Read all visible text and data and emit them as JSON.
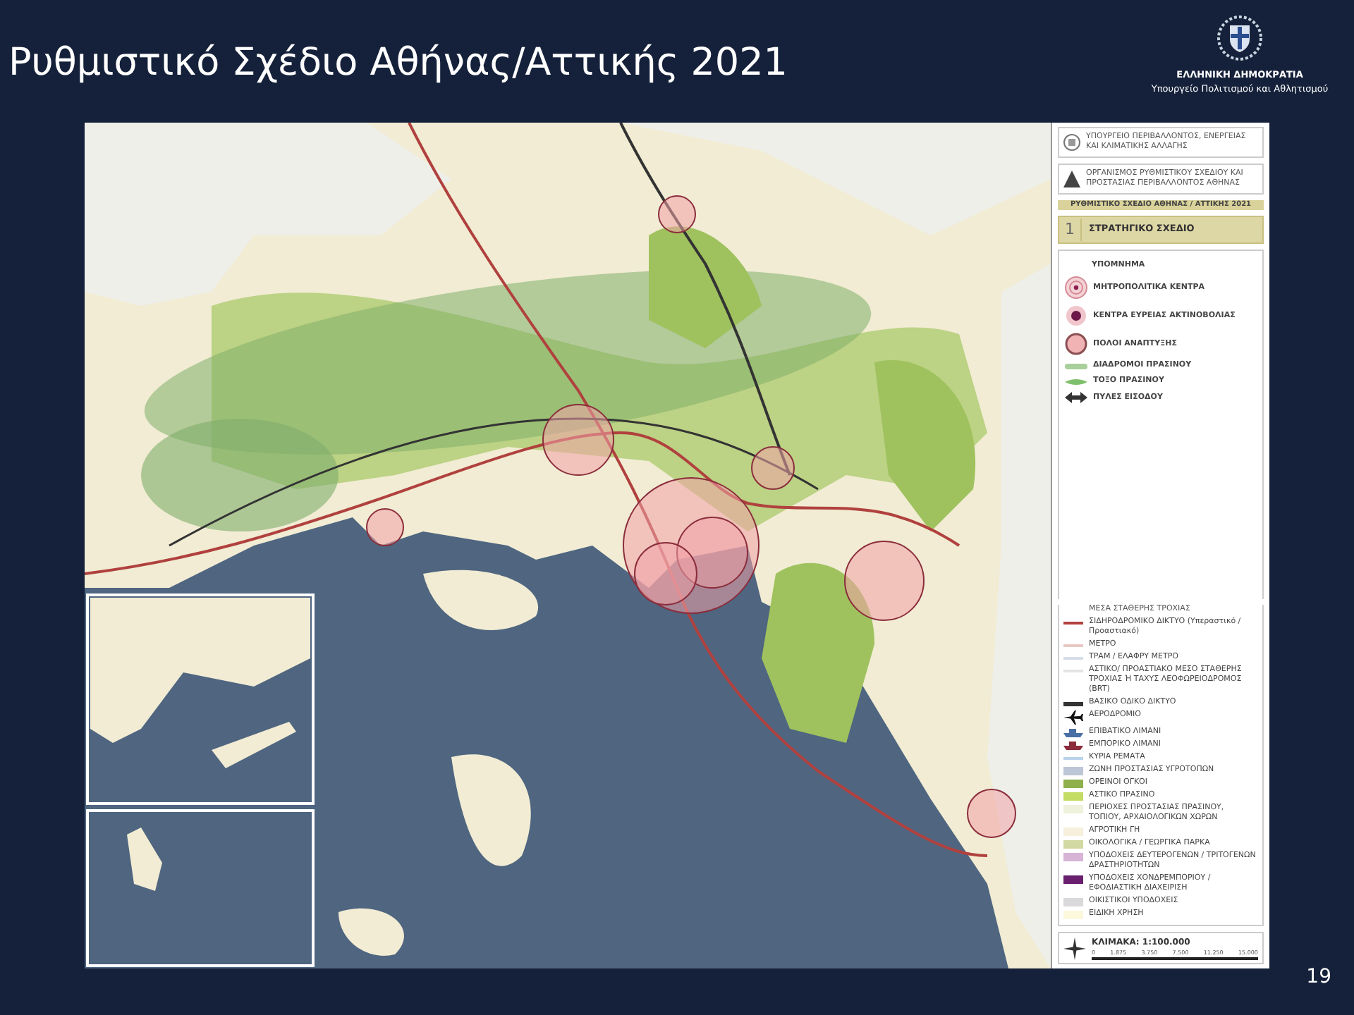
{
  "slide": {
    "title": "Ρυθμιστικό Σχέδιο Αθήνας/Αττικής 2021",
    "page_number": "19"
  },
  "branding": {
    "country": "ΕΛΛΗΝΙΚΗ ΔΗΜΟΚΡΑΤΙΑ",
    "ministry": "Υπουργείο Πολιτισμού και Αθλητισμού"
  },
  "legend": {
    "ministry": "ΥΠΟΥΡΓΕΙΟ ΠΕΡΙΒΑΛΛΟΝΤΟΣ, ΕΝΕΡΓΕΙΑΣ ΚΑΙ ΚΛΙΜΑΤΙΚΗΣ ΑΛΛΑΓΗΣ",
    "organization": "ΟΡΓΑΝΙΣΜΟΣ ΡΥΘΜΙΣΤΙΚΟΥ ΣΧΕΔΙΟΥ ΚΑΙ ΠΡΟΣΤΑΣΙΑΣ ΠΕΡΙΒΑΛΛΟΝΤΟΣ ΑΘΗΝΑΣ",
    "plan_title": "ΡΥΘΜΙΣΤΙΚΟ ΣΧΕΔΙΟ ΑΘΗΝΑΣ / ΑΤΤΙΚΗΣ 2021",
    "section_number": "1",
    "section_title": "ΣΤΡΑΤΗΓΙΚΟ ΣΧΕΔΙΟ",
    "heading": "ΥΠΟΜΝΗΜΑ",
    "symbols": [
      {
        "kind": "target",
        "label": "ΜΗΤΡΟΠΟΛΙΤΙΚΑ ΚΕΝΤΡΑ"
      },
      {
        "kind": "dot",
        "label": "ΚΕΝΤΡΑ ΕΥΡΕΙΑΣ ΑΚΤΙΝΟΒΟΛΙΑΣ"
      },
      {
        "kind": "pole",
        "label": "ΠΟΛΟΙ ΑΝΑΠΤΥΞΗΣ"
      },
      {
        "kind": "band",
        "label": "ΔΙΑΔΡΟΜΟΙ ΠΡΑΣΙΝΟΥ"
      },
      {
        "kind": "arc",
        "label": "ΤΟΞΟ ΠΡΑΣΙΝΟΥ"
      },
      {
        "kind": "gate",
        "label": "ΠΥΛΕΣ ΕΙΣΟΔΟΥ"
      }
    ],
    "features": [
      {
        "kind": "heading",
        "label": "ΜΕΣΑ ΣΤΑΘΕΡΗΣ ΤΡΟΧΙΑΣ"
      },
      {
        "kind": "line",
        "color": "#b0413e",
        "label": "ΣΙΔΗΡΟΔΡΟΜΙΚΟ ΔΙΚΤΥΟ (Υπεραστικό / Προαστιακό)"
      },
      {
        "kind": "line",
        "color": "#e8c9c4",
        "label": "ΜΕΤΡΟ"
      },
      {
        "kind": "line",
        "color": "#d6dde6",
        "label": "ΤΡΑΜ / ΕΛΑΦΡΥ ΜΕΤΡΟ"
      },
      {
        "kind": "line",
        "color": "#e4e4e4",
        "label": "ΑΣΤΙΚΟ/ ΠΡΟΑΣΤΙΑΚΟ ΜΕΣΟ ΣΤΑΘΕΡΗΣ ΤΡΟΧΙΑΣ Ή ΤΑΧΥΣ ΛΕΟΦΩΡΕΙΟΔΡΟΜΟΣ (BRT)"
      },
      {
        "kind": "road",
        "color": "#333333",
        "label": "ΒΑΣΙΚΟ ΟΔΙΚΟ ΔΙΚΤΥΟ"
      },
      {
        "kind": "plane",
        "color": "#111111",
        "label": "ΑΕΡΟΔΡΟΜΙΟ"
      },
      {
        "kind": "ship",
        "color": "#4a6fa5",
        "label": "ΕΠΙΒΑΤΙΚΟ ΛΙΜΑΝΙ"
      },
      {
        "kind": "ship",
        "color": "#8b2d3c",
        "label": "ΕΜΠΟΡΙΚΟ ΛΙΜΑΝΙ"
      },
      {
        "kind": "line",
        "color": "#b9d3ea",
        "label": "ΚΥΡΙΑ ΡΕΜΑΤΑ"
      },
      {
        "kind": "swatch",
        "color": "#bcc6d6",
        "label": "ΖΩΝΗ ΠΡΟΣΤΑΣΙΑΣ ΥΓΡΟΤΟΠΩΝ"
      },
      {
        "kind": "swatch",
        "color": "#8fb04a",
        "label": "ΟΡΕΙΝΟΙ ΟΓΚΟΙ"
      },
      {
        "kind": "swatch",
        "color": "#c3dc64",
        "label": "ΑΣΤΙΚΟ ΠΡΑΣΙΝΟ"
      },
      {
        "kind": "swatch",
        "color": "#eef2dc",
        "label": "ΠΕΡΙΟΧΕΣ ΠΡΟΣΤΑΣΙΑΣ ΠΡΑΣΙΝΟΥ, ΤΟΠΙΟΥ, ΑΡΧΑΙΟΛΟΓΙΚΩΝ ΧΩΡΩΝ"
      },
      {
        "kind": "swatch",
        "color": "#f6f0dc",
        "label": "ΑΓΡΟΤΙΚΗ ΓΗ"
      },
      {
        "kind": "swatch",
        "color": "#d3d9a3",
        "label": "ΟΙΚΟΛΟΓΙΚΑ / ΓΕΩΡΓΙΚΑ ΠΑΡΚΑ"
      },
      {
        "kind": "swatch",
        "color": "#d7b3d6",
        "label": "ΥΠΟΔΟΧΕΙΣ ΔΕΥΤΕΡΟΓΕΝΩΝ / ΤΡΙΤΟΓΕΝΩΝ ΔΡΑΣΤΗΡΙΟΤΗΤΩΝ"
      },
      {
        "kind": "swatch",
        "color": "#6a1f6e",
        "label": "ΥΠΟΔΟΧΕΙΣ ΧΟΝΔΡΕΜΠΟΡΙΟΥ / ΕΦΟΔΙΑΣΤΙΚΗ ΔΙΑΧΕΙΡΙΣΗ"
      },
      {
        "kind": "swatch",
        "color": "#d9d9dc",
        "label": "ΟΙΚΙΣΤΙΚΟΙ ΥΠΟΔΟΧΕΙΣ"
      },
      {
        "kind": "swatch",
        "color": "#fbf8dc",
        "label": "ΕΙΔΙΚΗ ΧΡΗΣΗ"
      }
    ],
    "scale": "ΚΛΙΜΑΚΑ: 1:100.000",
    "scale_ticks": [
      "0",
      "1.875",
      "3.750",
      "7.500",
      "11.250",
      "15.000"
    ]
  }
}
